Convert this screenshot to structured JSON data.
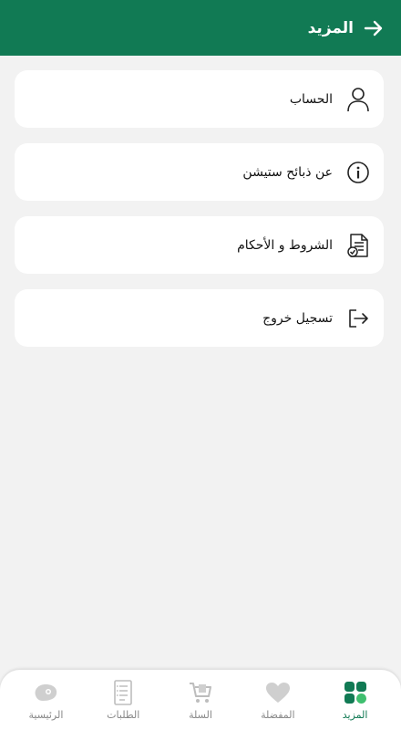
{
  "header": {
    "title": "المزيد"
  },
  "menu": {
    "items": [
      {
        "label": "الحساب",
        "icon": "user-icon"
      },
      {
        "label": "عن ذبائح ستيشن",
        "icon": "info-icon"
      },
      {
        "label": "الشروط و الأحكام",
        "icon": "terms-document-icon"
      },
      {
        "label": "تسجيل خروج",
        "icon": "logout-icon"
      }
    ]
  },
  "bottom_nav": {
    "items": [
      {
        "label": "المزيد",
        "icon": "grid-icon",
        "active": true
      },
      {
        "label": "المفضلة",
        "icon": "heart-icon",
        "active": false
      },
      {
        "label": "السلة",
        "icon": "cart-icon",
        "active": false
      },
      {
        "label": "الطلبات",
        "icon": "orders-list-icon",
        "active": false
      },
      {
        "label": "الرئيسية",
        "icon": "meat-home-icon",
        "active": false
      }
    ]
  },
  "colors": {
    "primary": "#117a54",
    "accent_light": "#3fbf6f",
    "inactive": "#c8c8c8",
    "background": "#f2f2f2"
  }
}
